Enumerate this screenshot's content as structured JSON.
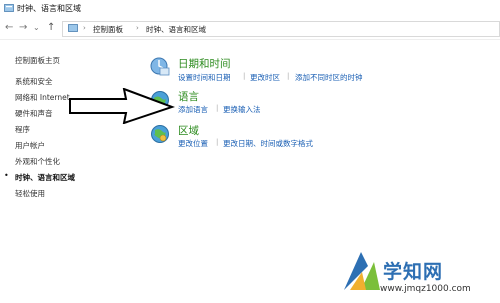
{
  "window": {
    "title": "时钟、语言和区域"
  },
  "address": {
    "back": "←",
    "forward": "→",
    "recent": "⌄",
    "up": "↑",
    "crumbs": [
      "控制面板",
      "时钟、语言和区域"
    ],
    "separator": "›"
  },
  "sidebar": {
    "home": "控制面板主页",
    "items": [
      "系统和安全",
      "网络和 Internet",
      "硬件和声音",
      "程序",
      "用户帐户",
      "外观和个性化",
      "时钟、语言和区域",
      "轻松使用"
    ],
    "active_index": 6,
    "bullet": "•"
  },
  "categories": [
    {
      "title": "日期和时间",
      "links": [
        "设置时间和日期",
        "更改时区",
        "添加不同时区的时钟"
      ]
    },
    {
      "title": "语言",
      "links": [
        "添加语言",
        "更换输入法"
      ]
    },
    {
      "title": "区域",
      "links": [
        "更改位置",
        "更改日期、时间或数字格式"
      ]
    }
  ],
  "link_separator": "|",
  "watermark": {
    "name": "学知网",
    "url": "www.jmqz1000.com"
  },
  "colors": {
    "title_green": "#2c8b1e",
    "link_blue": "#1a5fb4",
    "arrow": "#000000"
  }
}
